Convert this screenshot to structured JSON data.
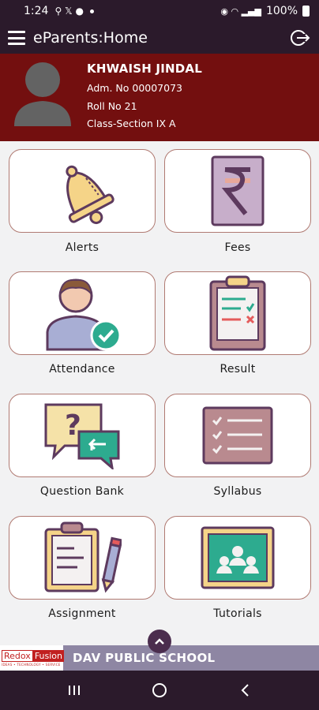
{
  "status_bar": {
    "time": "1:24",
    "battery": "100%"
  },
  "app_bar": {
    "title": "eParents:Home"
  },
  "profile": {
    "name": "KHWAISH JINDAL",
    "admission": "Adm. No 00007073",
    "roll": "Roll No 21",
    "class_section": "Class-Section IX A"
  },
  "tiles": [
    {
      "label": "Alerts",
      "icon": "bell-icon"
    },
    {
      "label": "Fees",
      "icon": "rupee-icon"
    },
    {
      "label": "Attendance",
      "icon": "attendance-user-check-icon"
    },
    {
      "label": "Result",
      "icon": "clipboard-result-icon"
    },
    {
      "label": "Question Bank",
      "icon": "question-chat-icon"
    },
    {
      "label": "Syllabus",
      "icon": "checklist-icon"
    },
    {
      "label": "Assignment",
      "icon": "clipboard-pen-icon"
    },
    {
      "label": "Tutorials",
      "icon": "classroom-board-icon"
    }
  ],
  "footer": {
    "brand_left": "Redox",
    "brand_right": "Fusion",
    "brand_tagline": "IDEAS • TECHNOLOGY • SERVICE",
    "school_name": "DAV PUBLIC SCHOOL"
  },
  "colors": {
    "app_bar": "#2b1a2b",
    "profile_bg": "#730f0f",
    "tile_border": "#b07a72",
    "footer_bg": "#8e86a3"
  }
}
